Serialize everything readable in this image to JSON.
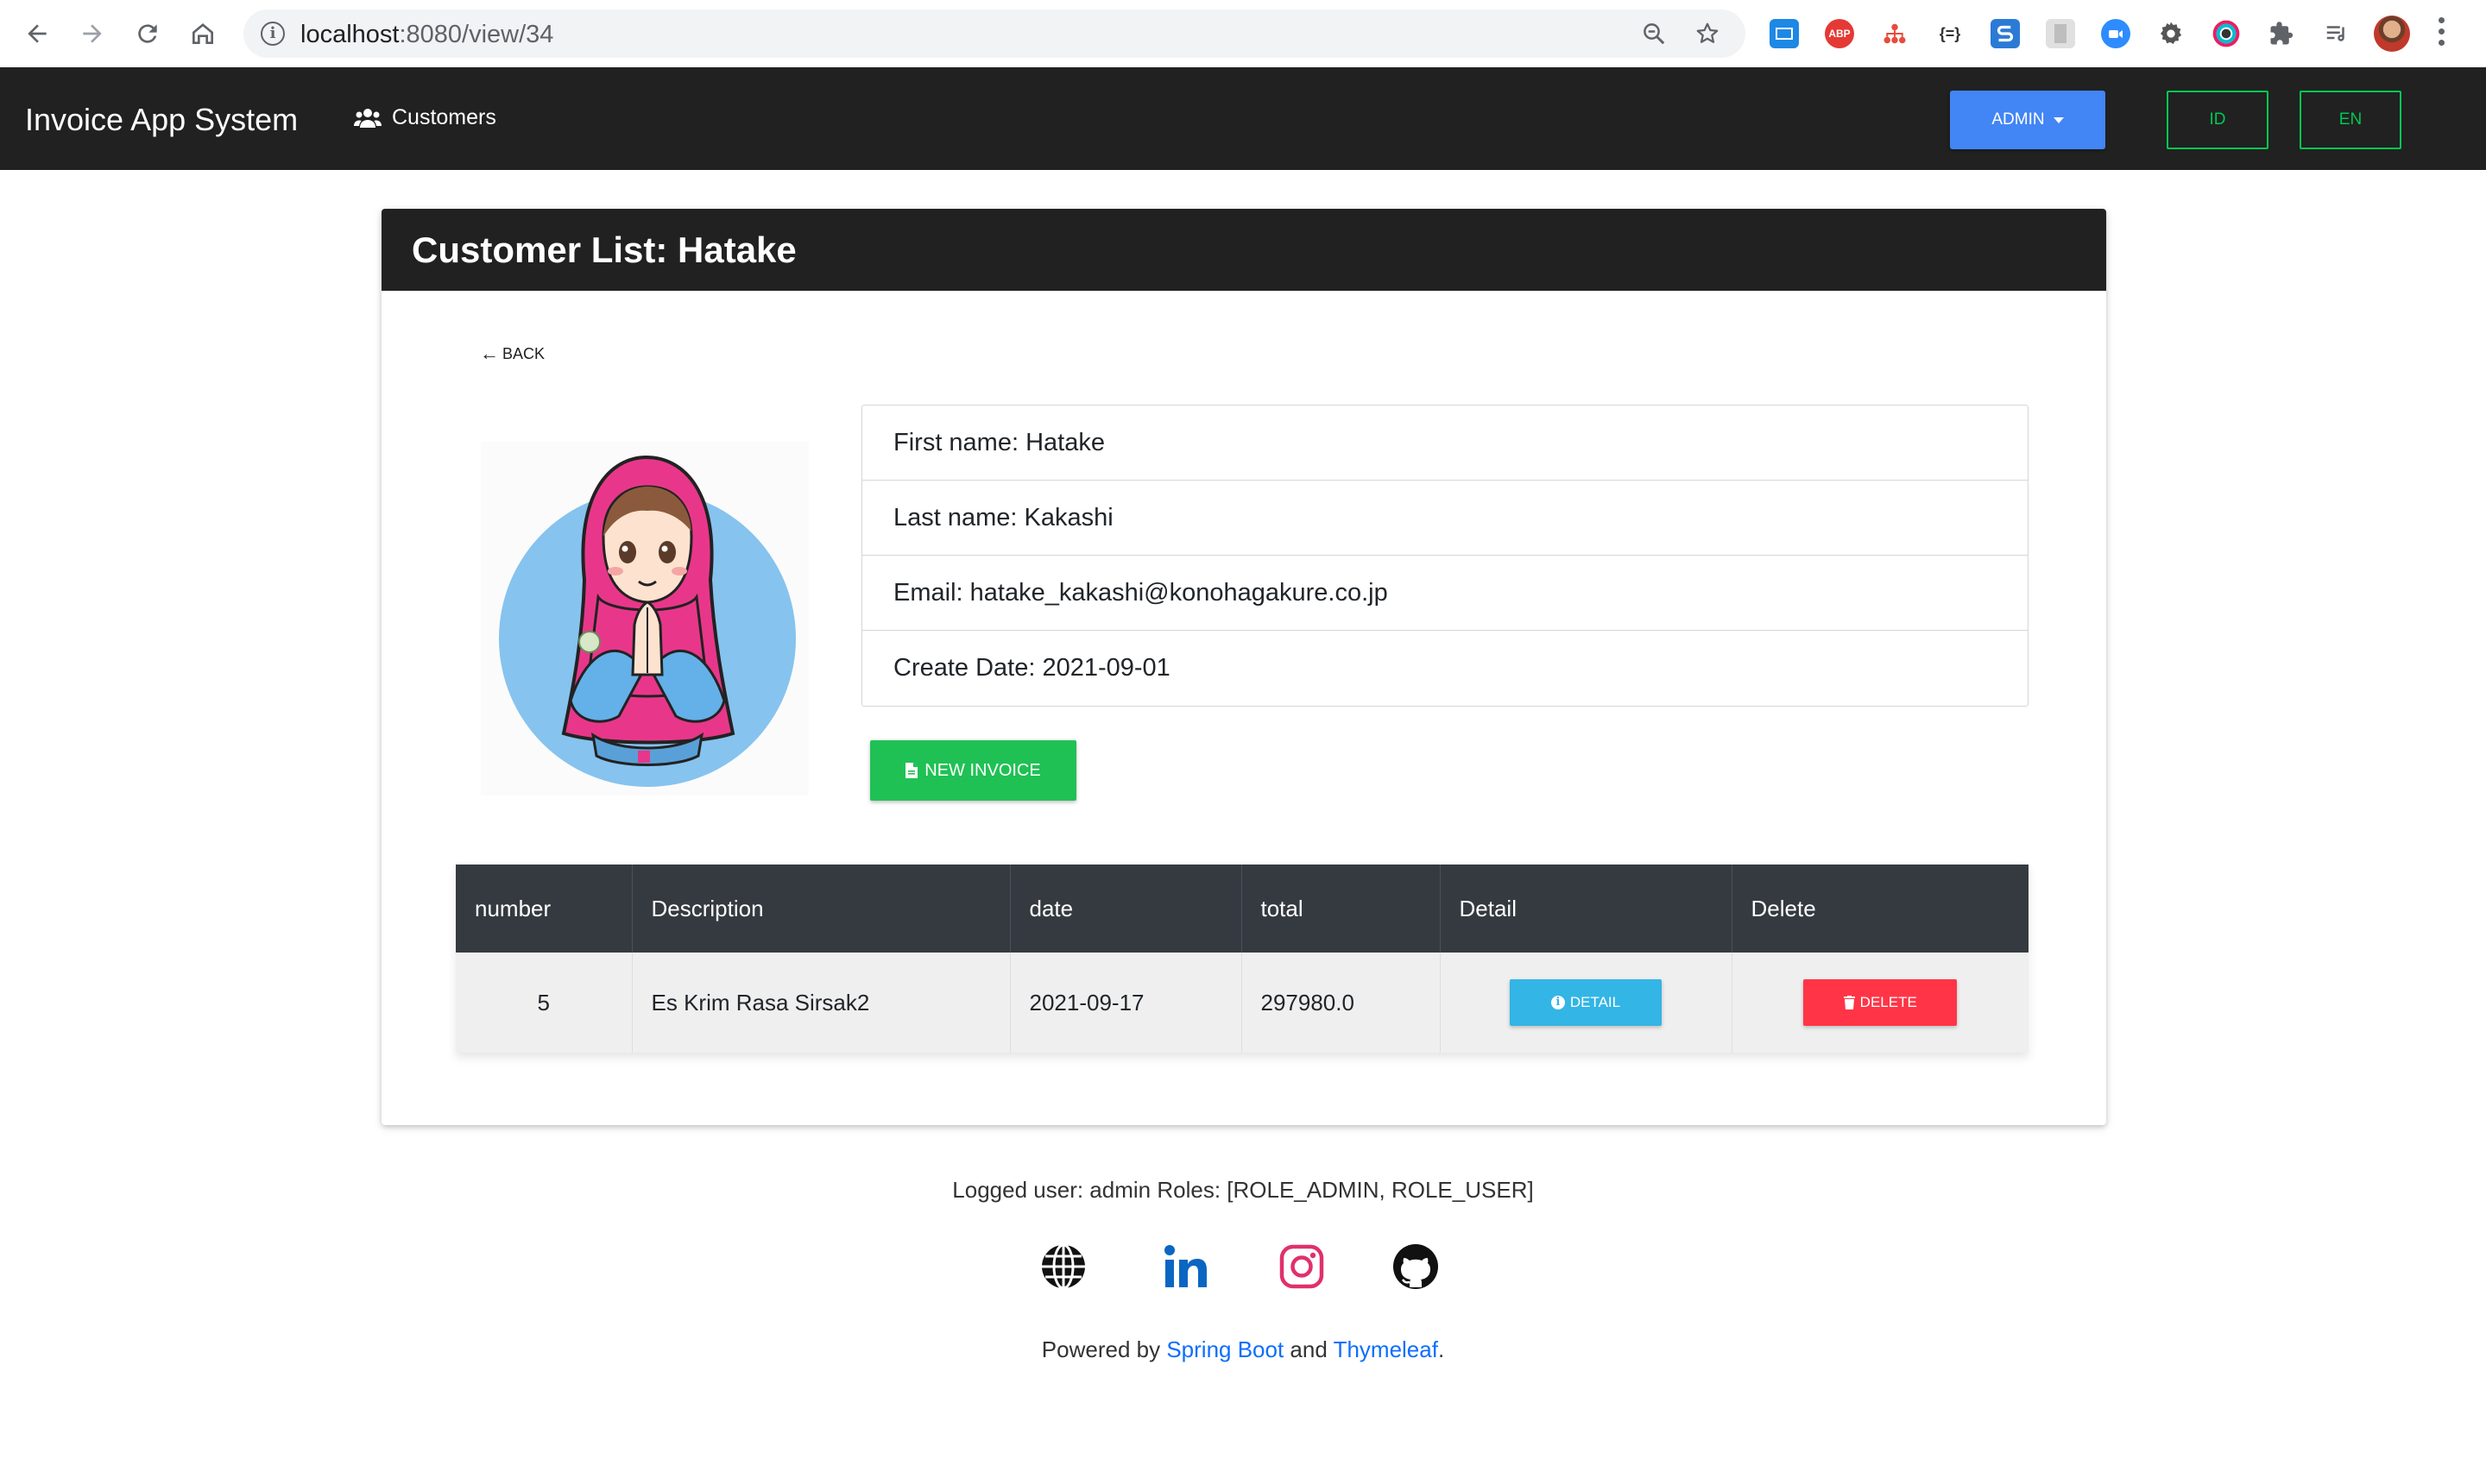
{
  "browser": {
    "url_host": "localhost",
    "url_path": ":8080/view/34"
  },
  "navbar": {
    "brand": "Invoice App System",
    "customers_label": "Customers",
    "admin_label": "ADMIN",
    "lang_id": "ID",
    "lang_en": "EN",
    "accent_colors": {
      "admin": "#4285f4",
      "lang": "#00c851"
    }
  },
  "card": {
    "title": "Customer List: Hatake",
    "back_label": "BACK",
    "info": {
      "first_name": "First name: Hatake",
      "last_name": "Last name: Kakashi",
      "email": "Email: hatake_kakashi@konohagakure.co.jp",
      "create_date": "Create Date: 2021-09-01"
    },
    "new_invoice_label": "NEW INVOICE"
  },
  "invoices": {
    "headers": [
      "number",
      "Description",
      "date",
      "total",
      "Detail",
      "Delete"
    ],
    "rows": [
      {
        "number": "5",
        "description": "Es Krim Rasa Sirsak2",
        "date": "2021-09-17",
        "total": "297980.0",
        "detail_label": "DETAIL",
        "delete_label": "DELETE"
      }
    ]
  },
  "footer": {
    "logged_user": "Logged user: admin Roles: [ROLE_ADMIN, ROLE_USER]",
    "powered_prefix": "Powered by ",
    "spring_boot": "Spring Boot",
    "and": " and ",
    "thymeleaf": "Thymeleaf",
    "period": ".",
    "social_icons": [
      "globe-icon",
      "linkedin-icon",
      "instagram-icon",
      "github-icon"
    ]
  }
}
